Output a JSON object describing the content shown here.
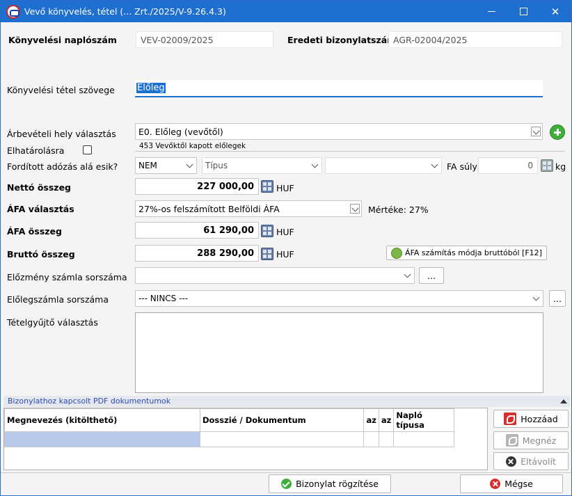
{
  "window": {
    "title": "Vevő könyvelés, tétel (... Zrt./2025/V-9.26.4.3)"
  },
  "header": {
    "journal_label": "Könyvelési naplószám",
    "journal_value": "VEV-02009/2025",
    "orig_doc_label": "Eredeti bizonylatszám",
    "orig_doc_value": "AGR-02004/2025"
  },
  "form": {
    "item_text_label": "Könyvelési tétel szövege",
    "item_text_value": "Előleg",
    "revenue_place_label": "Árbevételi hely választás",
    "revenue_place_value": "E0. Előleg (vevőtől)",
    "revenue_place_sub": "453 Vevőktől kapott előlegek",
    "accrual_label": "Elhatárolásra",
    "reverse_label": "Fordított adózás alá esik?",
    "reverse_value": "NEM",
    "type_placeholder": "Típus",
    "fa_label": "FA súly",
    "fa_value": "0",
    "fa_unit": "kg",
    "net_label": "Nettó összeg",
    "net_value": "227 000,00",
    "currency": "HUF",
    "vat_choice_label": "ÁFA választás",
    "vat_choice_value": "27%-os felszámított Belföldi ÁFA",
    "vat_rate_text": "Mértéke: 27%",
    "vat_amount_label": "ÁFA összeg",
    "vat_amount_value": "61 290,00",
    "gross_label": "Bruttó összeg",
    "gross_value": "288 290,00",
    "vat_calc_button": "ÁFA számítás módja bruttóból [F12]",
    "prev_invoice_label": "Előzmény számla sorszáma",
    "prev_invoice_value": "",
    "advance_invoice_label": "Előlegszámla sorszáma",
    "advance_invoice_value": "--- NINCS ---",
    "collector_label": "Tételgyűjtő választás",
    "ellipsis": "..."
  },
  "pdf_panel": {
    "title": "Bizonylathoz kapcsolt PDF dokumentumok",
    "columns": [
      "Megnevezés (kitölthető)",
      "Dosszié / Dokumentum",
      "az",
      "az",
      "Napló típusa"
    ],
    "add_button": "Hozzáad",
    "view_button": "Megnéz",
    "remove_button": "Eltávolít"
  },
  "footer": {
    "save_button": "Bizonylat rögzítése",
    "cancel_button": "Mégse"
  },
  "colors": {
    "titlebar": "#1e6fd0",
    "selection_row": "#b7c9e8",
    "panel_header_text": "#2b49b0"
  }
}
